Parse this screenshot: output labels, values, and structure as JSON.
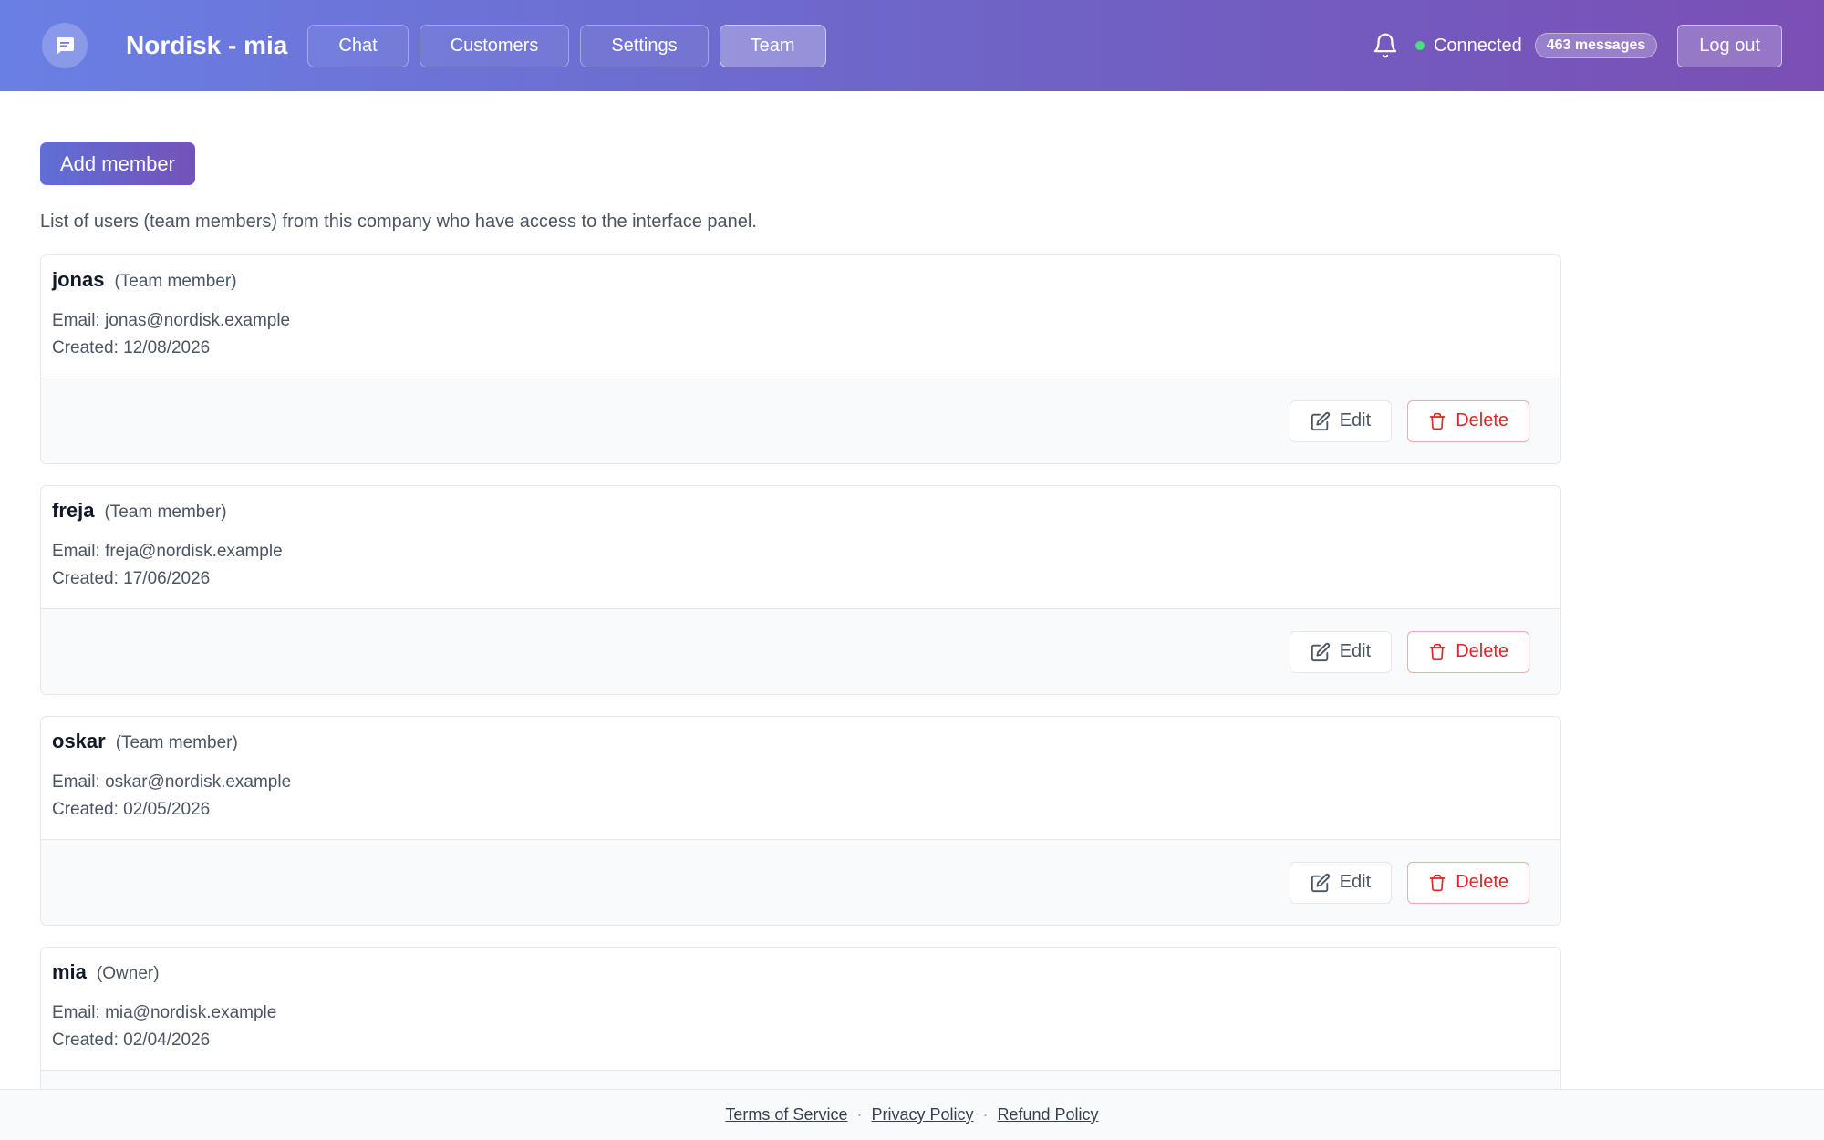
{
  "header": {
    "title": "Nordisk - mia",
    "nav": [
      "Chat",
      "Customers",
      "Settings",
      "Team"
    ],
    "active_nav": "Team",
    "status": "Connected",
    "messages_badge": "463 messages",
    "logout_label": "Log out",
    "status_color": "#4ade80"
  },
  "main": {
    "add_member_label": "Add member",
    "description": "List of users (team members) from this company who have access to the interface panel.",
    "edit_label": "Edit",
    "delete_label": "Delete",
    "members": [
      {
        "name": "jonas",
        "role": "(Team member)",
        "email": "Email: jonas@nordisk.example",
        "created": "Created: 12/08/2026"
      },
      {
        "name": "freja",
        "role": "(Team member)",
        "email": "Email: freja@nordisk.example",
        "created": "Created: 17/06/2026"
      },
      {
        "name": "oskar",
        "role": "(Team member)",
        "email": "Email: oskar@nordisk.example",
        "created": "Created: 02/05/2026"
      },
      {
        "name": "mia",
        "role": "(Owner)",
        "email": "Email: mia@nordisk.example",
        "created": "Created: 02/04/2026"
      }
    ]
  },
  "footer": {
    "links": [
      "Terms of Service",
      "Privacy Policy",
      "Refund Policy"
    ],
    "separator": "·"
  }
}
